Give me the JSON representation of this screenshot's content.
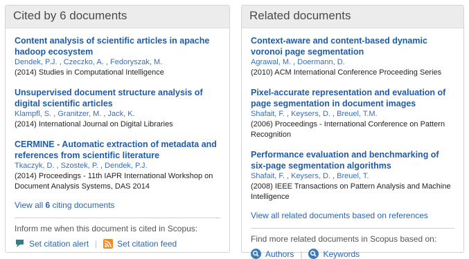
{
  "cited_by": {
    "header": "Cited by 6 documents",
    "documents": [
      {
        "title": "Content analysis of scientific articles in apache hadoop ecosystem",
        "authors": [
          "Dendek, P.J.",
          "Czeczko, A.",
          "Fedoryszak, M."
        ],
        "source": "(2014) Studies in Computational Intelligence"
      },
      {
        "title": "Unsupervised document structure analysis of digital scientific articles",
        "authors": [
          "Klampfl, S.",
          "Granitzer, M.",
          "Jack, K."
        ],
        "source": "(2014) International Journal on Digital Libraries"
      },
      {
        "title": "CERMINE - Automatic extraction of metadata and references from scientific literature",
        "authors": [
          "Tkaczyk, D.",
          "Szostek, P.",
          "Dendek, P.J."
        ],
        "source": "(2014) Proceedings - 11th IAPR International Workshop on Document Analysis Systems, DAS 2014"
      }
    ],
    "view_all_prefix": "View all ",
    "view_all_count": "6",
    "view_all_suffix": " citing documents",
    "inform_label": "Inform me when this document is cited in Scopus:",
    "set_alert_label": "Set citation alert",
    "set_feed_label": "Set citation feed"
  },
  "related": {
    "header": "Related documents",
    "documents": [
      {
        "title": "Context-aware and content-based dynamic voronoi page segmentation",
        "authors": [
          "Agrawal, M.",
          "Doermann, D."
        ],
        "source": "(2010) ACM International Conference Proceeding Series"
      },
      {
        "title": "Pixel-accurate representation and evaluation of page segmentation in document images",
        "authors": [
          "Shafait, F.",
          "Keysers, D.",
          "Breuel, T.M."
        ],
        "source": "(2006) Proceedings - International Conference on Pattern Recognition"
      },
      {
        "title": "Performance evaluation and benchmarking of six-page segmentation algorithms",
        "authors": [
          "Shafait, F.",
          "Keysers, D.",
          "Breuel, T."
        ],
        "source": "(2008) IEEE Transactions on Pattern Analysis and Machine Intelligence"
      }
    ],
    "view_all_label": "View all related documents based on references",
    "find_more_label": "Find more related documents in Scopus based on:",
    "authors_label": "Authors",
    "keywords_label": "Keywords"
  },
  "colors": {
    "link": "#1f5ba6",
    "header_bg": "#ececec",
    "rss_orange": "#ee8a22",
    "alert_teal": "#2f7f8f"
  },
  "icons": [
    "bell-icon",
    "rss-icon",
    "search-icon"
  ]
}
